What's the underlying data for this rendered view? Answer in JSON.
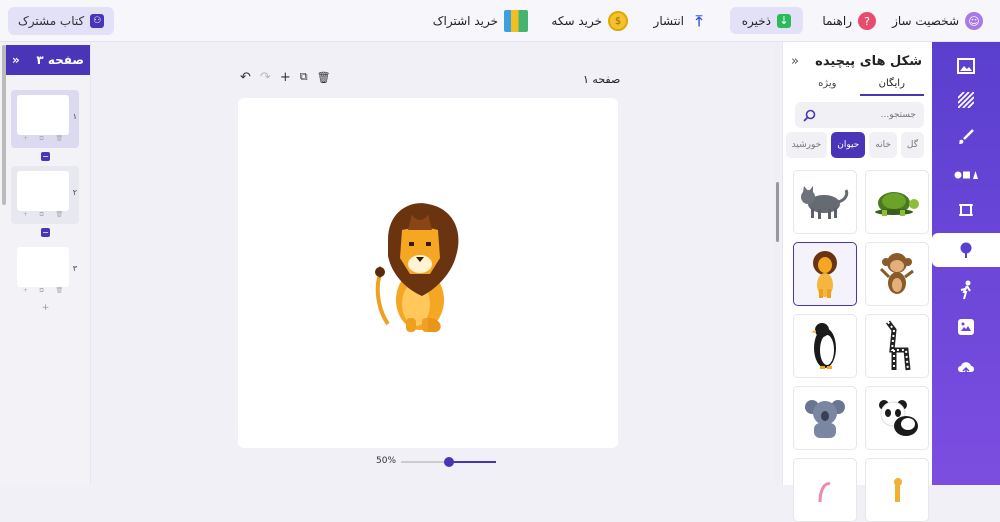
{
  "topbar": {
    "character_maker": "شخصیت ساز",
    "help": "راهنما",
    "save": "ذخیره",
    "publish": "انتشار",
    "buy_coin": "خرید سکه",
    "buy_subscription": "خرید اشتراک",
    "shared_book": "کتاب مشترک"
  },
  "library": {
    "title": "شکل های پیچیده",
    "tabs": [
      "رایگان",
      "ویژه"
    ],
    "active_tab": "رایگان",
    "search_placeholder": "جستجو...",
    "chips": [
      "گل",
      "خانه",
      "حیوان",
      "خورشید"
    ],
    "active_chip": "حیوان",
    "items": [
      "turtle",
      "cat",
      "monkey",
      "lion",
      "zebra",
      "penguin",
      "panda",
      "koala",
      "giraffe",
      "flamingo"
    ]
  },
  "pages_panel": {
    "title": "۳ صفحه",
    "pages": [
      {
        "num": "۱",
        "selected": true
      },
      {
        "num": "۲",
        "selected": false
      },
      {
        "num": "۳",
        "selected": false
      }
    ]
  },
  "canvas": {
    "page_label": "صفحه ۱"
  },
  "zoom": {
    "label": "50%",
    "value": 0.5
  },
  "colors": {
    "accent": "#4a35b8",
    "rail": "#6a46d8"
  }
}
